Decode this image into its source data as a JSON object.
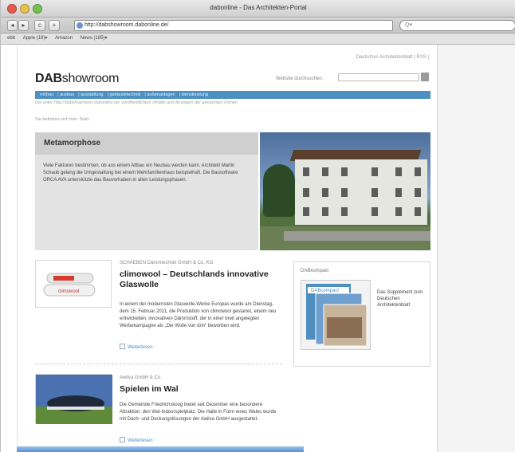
{
  "window": {
    "title": "dabonline - Das Architekten-Portal"
  },
  "toolbar": {
    "back": "◂",
    "forward": "▸",
    "reload": "c",
    "add": "+",
    "url": "http://dabshowroom.dabonline.de/",
    "search_placeholder": "Q▾"
  },
  "bookmarks": [
    "ebb",
    "Apple (19)▾",
    "Amazon",
    "News (185)▾"
  ],
  "site": {
    "top_links": "Deutsches Architektenblatt | RSS |",
    "logo_prefix": "DAB",
    "logo_suffix": "showroom",
    "search_label": "Website durchsuchen:",
    "nav": [
      "rohbau",
      "ausbau",
      "ausstattung",
      "gebäudetechnik",
      "außenanlagen",
      "dienstleistung"
    ],
    "tagline": "Die unter http://dabshowroom.dabonline.de/ veröffentlichten Inhalte und Anzeigen der genannten Firmen",
    "breadcrumb": "Sie befinden sich hier: Start"
  },
  "feature": {
    "title": "Metamorphose",
    "text": "Viele Faktoren bestimmen, ob aus einem Altbau ein Neubau werden kann. Architekt Martin Schaub gelang die Umgestaltung bei einem Mehrfamilienhaus beispielhaft. Die Bausoftware ORCA AVA unterstützte das Bauvorhaben in allen Leistungsphasen."
  },
  "articles": [
    {
      "company": "SCHAEBEN Dämmtechnik GmbH & Co. KG",
      "title": "climowool – Deutschlands innovative Glaswolle",
      "text": "In einem der modernsten Glaswolle-Werke Europas wurde am Dienstag, dem 15. Februar 2011, die Produktion von climowool gestartet, einem neu entwickelten, innovativen Dämmstoff, der in einer breit angelegten Werbekampagne als „Die Wolle von drin“ beworben wird.",
      "more": "Weiterlesen",
      "product": "climowool"
    },
    {
      "company": "Awilva GmbH & Co.",
      "title": "Spielen im Wal",
      "text": "Die Gemeinde Friedrichskoog bietet seit Dezember eine besondere Attraktion: den Wal-Indoorspielplatz. Die Halle in Form eines Wales wurde mit Dach- und Deckungslösungen der Awilva GmbH ausgestattet.",
      "more": "Weiterlesen"
    }
  ],
  "sidebar": {
    "title": "DABkompakt",
    "cover_label": "DABcompact",
    "text": "Das Supplement zum Deutschen Architektenblatt"
  },
  "colors": {
    "nav": "#4d8fc0",
    "feature_bg": "#e3e3e3",
    "feature_head": "#cfcfcf"
  }
}
